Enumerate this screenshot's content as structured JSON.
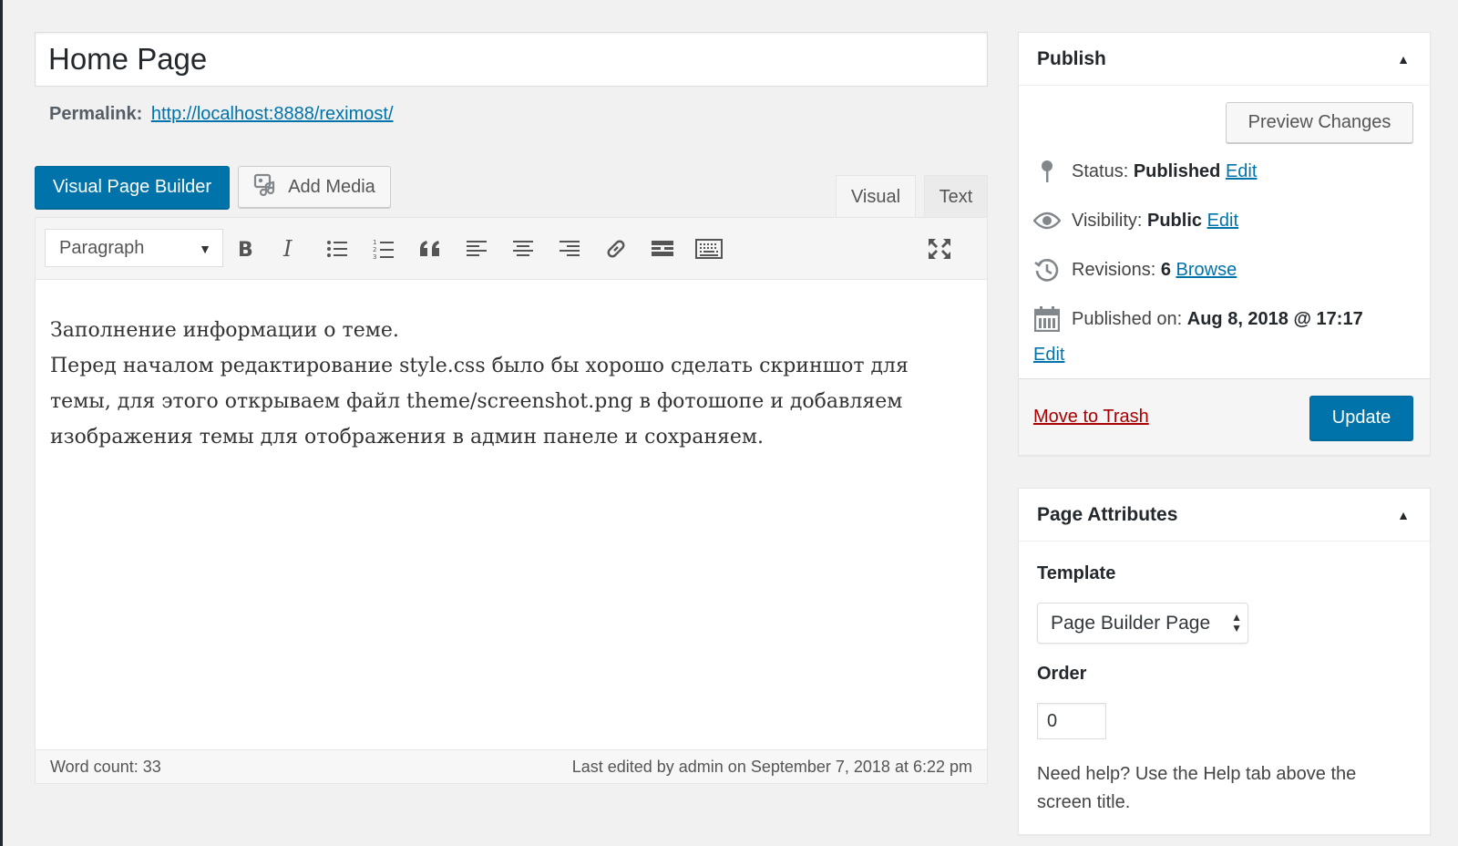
{
  "editor": {
    "title": "Home Page",
    "permalink_label": "Permalink:",
    "permalink_url": "http://localhost:8888/reximost/",
    "visual_page_builder_label": "Visual Page Builder",
    "add_media_label": "Add Media",
    "tabs": [
      {
        "label": "Visual",
        "active": true
      },
      {
        "label": "Text",
        "active": false
      }
    ],
    "format_select": "Paragraph",
    "toolbar_icons": [
      "bold-icon",
      "italic-icon",
      "bulleted-list-icon",
      "numbered-list-icon",
      "blockquote-icon",
      "align-left-icon",
      "align-center-icon",
      "align-right-icon",
      "link-icon",
      "read-more-icon",
      "toolbar-toggle-icon",
      "fullscreen-icon"
    ],
    "content_line1": "Заполнение информации о теме.",
    "content_line2": "Перед началом редактирование style.css было бы хорошо сделать скриншот для темы, для этого открываем файл theme/screenshot.png в фотошопе и добавляем изображения темы для отображения в админ панеле и сохраняем.",
    "word_count": "Word count: 33",
    "last_edited": "Last edited by admin on September 7, 2018 at 6:22 pm"
  },
  "publish": {
    "heading": "Publish",
    "preview_label": "Preview Changes",
    "status_label": "Status:",
    "status_value": "Published",
    "visibility_label": "Visibility:",
    "visibility_value": "Public",
    "revisions_label": "Revisions:",
    "revisions_value": "6",
    "browse_label": "Browse",
    "published_on_label": "Published on:",
    "published_on_value": "Aug 8, 2018 @ 17:17",
    "edit_label": "Edit",
    "trash_label": "Move to Trash",
    "update_label": "Update"
  },
  "attributes": {
    "heading": "Page Attributes",
    "template_label": "Template",
    "template_value": "Page Builder Page",
    "order_label": "Order",
    "order_value": "0",
    "help_text": "Need help? Use the Help tab above the screen title."
  },
  "colors": {
    "accent": "#0073aa",
    "trash": "#a00000",
    "background": "#f1f1f1"
  }
}
